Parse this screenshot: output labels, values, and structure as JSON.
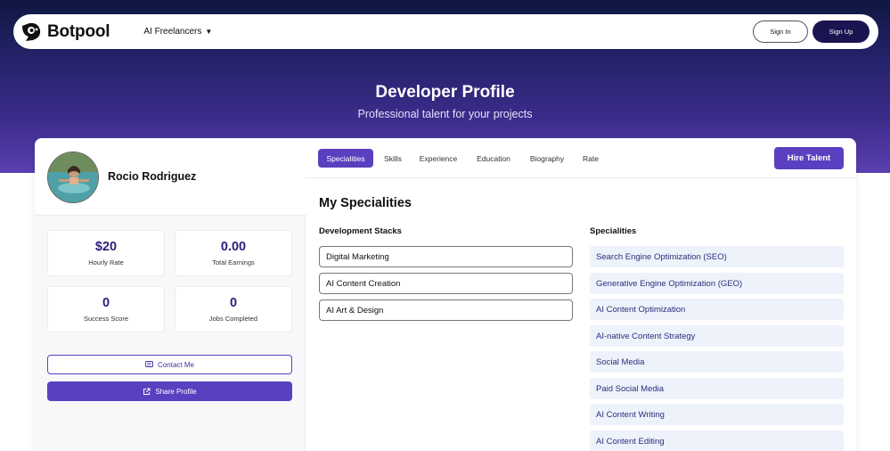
{
  "nav": {
    "brand": "Botpool",
    "menu_label": "AI Freelancers",
    "sign_in": "Sign In",
    "sign_up": "Sign Up"
  },
  "hero": {
    "title": "Developer Profile",
    "subtitle": "Professional talent for your projects"
  },
  "profile": {
    "name": "Rocio Rodriguez",
    "stats": [
      {
        "value": "$20",
        "label": "Hourly Rate"
      },
      {
        "value": "0.00",
        "label": "Total Earnings"
      },
      {
        "value": "0",
        "label": "Success Score"
      },
      {
        "value": "0",
        "label": "Jobs Completed"
      }
    ],
    "contact_label": "Contact Me",
    "share_label": "Share Profile"
  },
  "tabs": [
    {
      "label": "Specialities",
      "active": true
    },
    {
      "label": "Skills",
      "active": false
    },
    {
      "label": "Experience",
      "active": false
    },
    {
      "label": "Education",
      "active": false
    },
    {
      "label": "Biography",
      "active": false
    },
    {
      "label": "Rate",
      "active": false
    }
  ],
  "hire_label": "Hire Talent",
  "main": {
    "section_title": "My Specialities",
    "stacks_title": "Development Stacks",
    "stacks": [
      "Digital Marketing",
      "AI Content Creation",
      "AI Art & Design"
    ],
    "specialities_title": "Specialities",
    "specialities": [
      "Search Engine Optimization (SEO)",
      "Generative Engine Optimization (GEO)",
      "AI Content Optimization",
      "AI-native Content Strategy",
      "Social Media",
      "Paid Social Media",
      "AI Content Writing",
      "AI Content Editing"
    ]
  },
  "colors": {
    "accent": "#5a40c0",
    "hero_dark": "#0f1740",
    "hero_light": "#5a40b0",
    "speciality_bg": "#eef2fb"
  }
}
